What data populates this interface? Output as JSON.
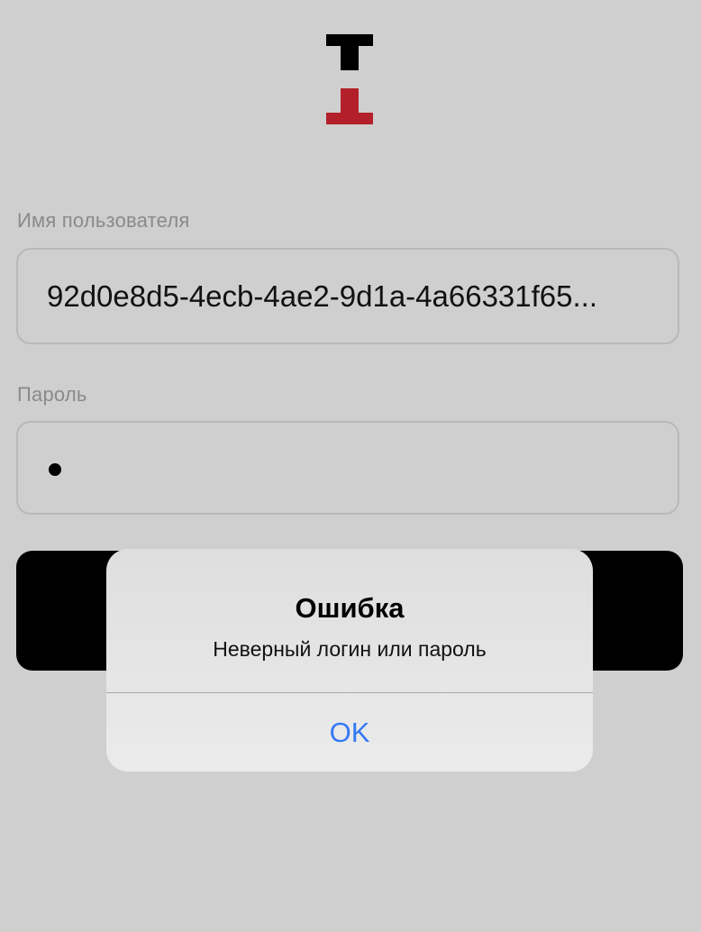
{
  "logo": {
    "name": "brand-logo",
    "colors": {
      "top": "#000000",
      "bottom": "#b3202a"
    }
  },
  "login_form": {
    "username": {
      "label": "Имя пользователя",
      "value": "92d0e8d5-4ecb-4ae2-9d1a-4a66331f65..."
    },
    "password": {
      "label": "Пароль",
      "masked_length": 1
    },
    "submit_button": {
      "label": ""
    }
  },
  "alert": {
    "title": "Ошибка",
    "message": "Неверный логин или пароль",
    "ok_label": "OK",
    "ok_color": "#3478f6"
  },
  "colors": {
    "background": "#cfcfcf",
    "field_border": "#b9b9b9",
    "label_text": "#8a8a8a"
  }
}
